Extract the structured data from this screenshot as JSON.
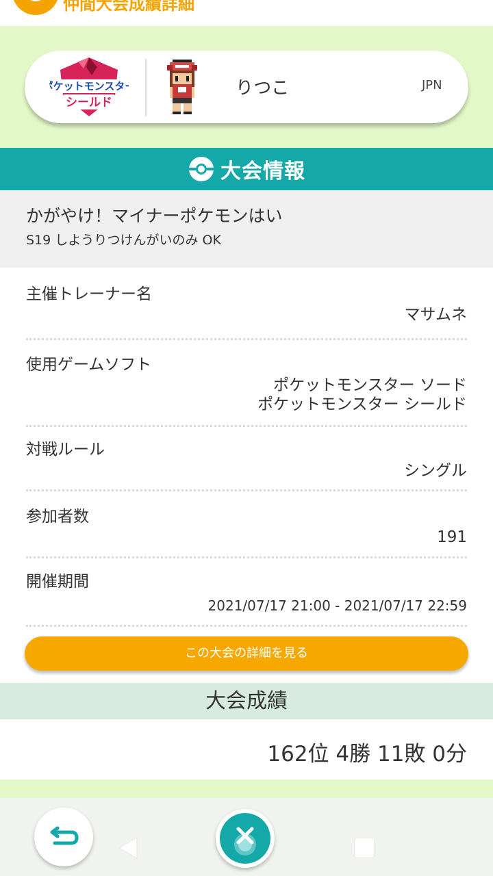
{
  "topbar": {
    "title": "仲間大会成績詳細"
  },
  "player": {
    "game_logo_text_top": "ポケットモンスター",
    "game_logo_text_bottom": "シールド",
    "name": "りつこ",
    "region": "JPN"
  },
  "section": {
    "title": "大会情報"
  },
  "tournament": {
    "name": "かがやけ！マイナーポケモンはい",
    "subtitle": "S19 しようりつけんがいのみ OK"
  },
  "info": {
    "organizer_label": "主催トレーナー名",
    "organizer_value": "マサムネ",
    "software_label": "使用ゲームソフト",
    "software_value_1": "ポケットモンスター ソード",
    "software_value_2": "ポケットモンスター シールド",
    "rule_label": "対戦ルール",
    "rule_value": "シングル",
    "participants_label": "参加者数",
    "participants_value": "191",
    "period_label": "開催期間",
    "period_value": "2021/07/17 21:00 - 2021/07/17 22:59"
  },
  "detail_button": {
    "label": "この大会の詳細を見る"
  },
  "results": {
    "title": "大会成績",
    "value": "162位 4勝 11敗 0分"
  },
  "colors": {
    "accent_orange": "#f7a800",
    "teal": "#14a8a8",
    "header_green": "#e3f8c9",
    "results_green": "#d7ebe0"
  },
  "nav": {
    "back_icon": "back-arrow-icon",
    "home_icon": "pokeball-home-icon"
  }
}
